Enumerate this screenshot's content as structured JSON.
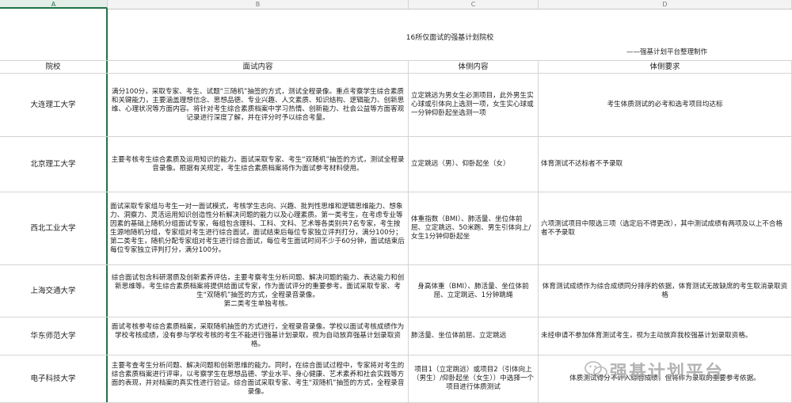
{
  "columns": [
    "A",
    "B",
    "C",
    "D"
  ],
  "sheet": {
    "title": "16所仅面试的强基计划院校",
    "credit": "——强基计划平台整理制作",
    "headers": {
      "school": "院校",
      "interview": "面试内容",
      "test": "体侧内容",
      "req": "体侧要求"
    },
    "rows": [
      {
        "school": "大连理工大学",
        "interview": "满分100分，采取专家、考生、试题“三随机”抽签的方式，测试全程录像。重点考察学生综合素质和关键能力，主要涵盖理想信念、思想品德、专业兴趣、人文素质、知识结构、逻辑能力、创新思维、心理状况等方面内容。将针对考生综合素质档案中学习热情、创新能力、社会公益等方面客观记录进行深度了解，并在评分时予以综合考量。",
        "test": "立定跳远为男女生必测项目，此外男生实心球或引体向上选测一项，女生实心球或一分钟仰卧起坐选测一项",
        "req": "考生体质测试的必考和选考项目均达标"
      },
      {
        "school": "北京理工大学",
        "interview": "主要考核考生综合素质及运用知识的能力。面试采取专家、考生“双随机”抽签的方式，测试全程录音录像。根据有关规定，考生综合素质档案将作为面试参考材料使用。",
        "test": "立定跳远（男）、仰卧起坐（女）",
        "req": "体育测试不达标者不予录取"
      },
      {
        "school": "西北工业大学",
        "interview": "面试采取专家组与考生一对一面试模式，考核学生志向、兴趣、批判性思维和逻辑思维能力、想象力、洞察力、灵活运用知识创造性分析解决问题的能力以及心理素质。第一类考生，在考虑专业等因素的基础上随机分组面试专家，每组包含理科、工科、文科、艺术等各类别共7名专家，考生按生源地随机分组，专家组对考生进行综合面试，面试结束后每位专家独立评判打分，满分100分；第二类考生，随机分配专家组对考生进行综合面试，每位考生面试时间不少于60分钟，面试结束后每位专家独立评判打分，满分100分。",
        "test": "体重指数（BMI）、肺活量、坐位体前屈、立定跳远、50米跑、男生引体向上/女生1分钟仰卧起坐",
        "req": "六项测试项目中限选三项（选定后不得更改），其中测试成绩有两项及以上不合格者不予录取"
      },
      {
        "school": "上海交通大学",
        "interview": "综合面试包含科研潜质及创新素养评估，主要考察考生分析问题、解决问题的能力、表达能力和创新思维等。考生综合素质档案将提供给面试专家，作为面试评分的重要参考。面试采取专家、考生“双随机”抽签的方式，全程录音录像。\n第二类考生单独考核。",
        "test": "身高体重（BMI）、肺活量、坐位体前屈、立定跳远、1分钟跳绳",
        "req": "体育测试成绩作为综合成绩同分排序的依据，体育测试无故缺席的考生取消录取资格"
      },
      {
        "school": "华东师范大学",
        "interview": "面试考核参考综合素质档案，采取随机抽签的方式进行，全程录音录像。学校以面试考核成绩作为学校考核成绩，没有参与学校考核的考生不能进行强基计划录取，视为自动放弃强基计划录取资格。",
        "test": "肺活量、坐位体前屈、立定跳远",
        "req": "未经申请不参加体育测试考生，视为主动放弃我校强基计划录取资格。"
      },
      {
        "school": "电子科技大学",
        "interview": "主要考查考生分析问题、解决问题和创新思维的能力。同时，在综合面试过程中，专家将对考生的综合素质档案进行评审，以考察学生在思想品德、学业水平、身心健康、艺术素养和社会实践等方面的表现，并对档案的真实性进行验证。综合面试采取专家、考生“双随机”抽签的方式，全程录音录像。",
        "test": "项目1（立定跳远）或项目2（引体向上（男生）/仰卧起坐（女生））中选择一个项目进行体质测试",
        "req": "体质测试得分不计入综合成绩，但将作为录取的重要参考依据。"
      }
    ]
  },
  "watermark": {
    "text": "强基计划平台",
    "icon": "wechat-icon"
  }
}
